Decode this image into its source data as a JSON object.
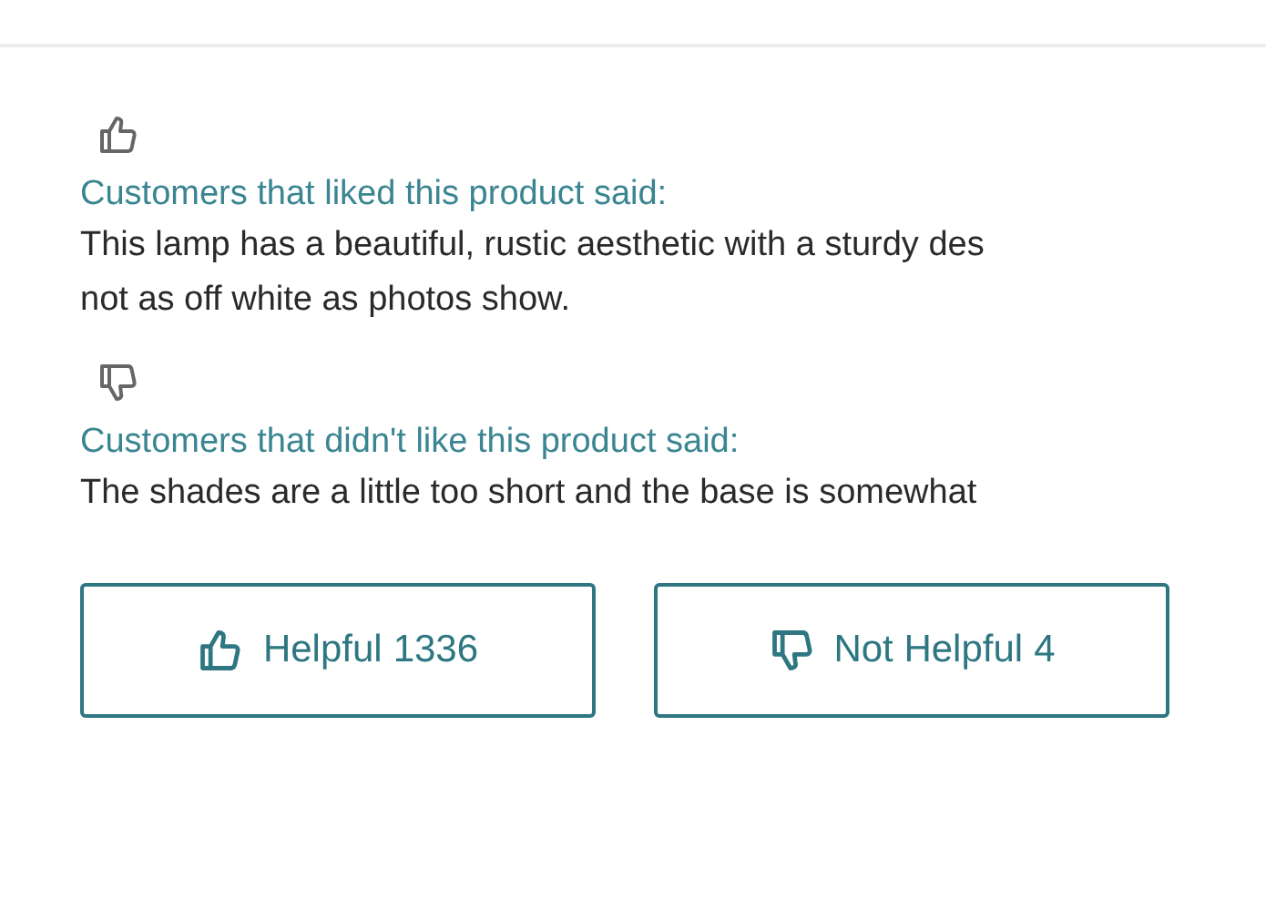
{
  "sections": [
    {
      "kind": "liked",
      "heading": "Customers that liked this product said:",
      "lines": [
        "This lamp has a beautiful, rustic aesthetic with a sturdy des",
        "not as off white as photos show."
      ]
    },
    {
      "kind": "disliked",
      "heading": "Customers that didn't like this product said:",
      "lines": [
        "The shades are a little too short and the base is somewhat"
      ]
    }
  ],
  "buttons": [
    {
      "kind": "up",
      "label": "Helpful",
      "count": "1336"
    },
    {
      "kind": "down",
      "label": "Not Helpful",
      "count": "4"
    }
  ]
}
